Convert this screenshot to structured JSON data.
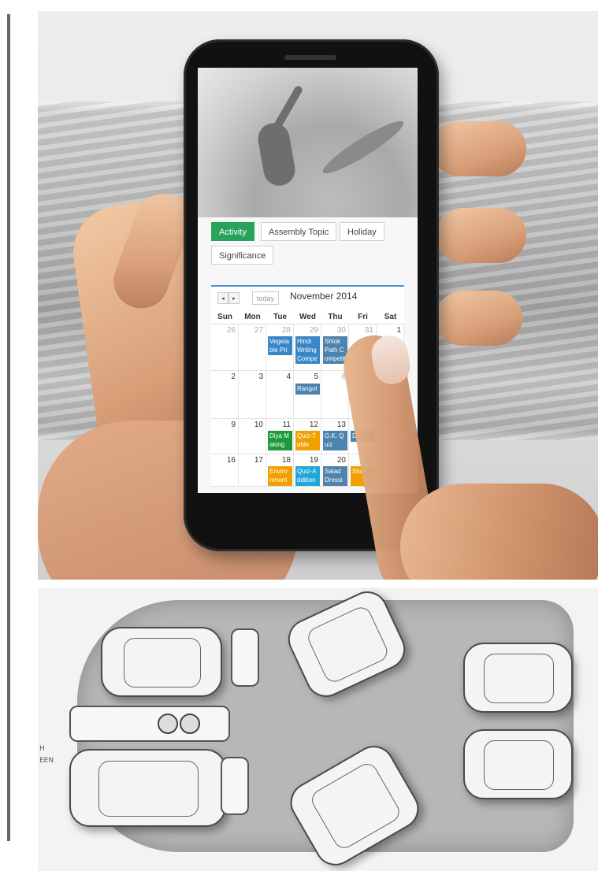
{
  "tabs": [
    "Activity",
    "Assembly Topic",
    "Holiday",
    "Significance"
  ],
  "calendar": {
    "prev_icon": "◂",
    "next_icon": "▸",
    "today_label": "today",
    "title": "November 2014",
    "weekdays": [
      "Sun",
      "Mon",
      "Tue",
      "Wed",
      "Thu",
      "Fri",
      "Sat"
    ],
    "weeks": [
      [
        "26",
        "27",
        "28",
        "29",
        "30",
        "31",
        "1"
      ],
      [
        "2",
        "3",
        "4",
        "5",
        "6",
        "",
        ""
      ],
      [
        "9",
        "10",
        "11",
        "12",
        "13",
        "",
        ""
      ],
      [
        "16",
        "17",
        "18",
        "19",
        "20",
        "21",
        ""
      ]
    ],
    "events": {
      "w0_tue": "Vegetable Printing",
      "w0_wed": "Hindi Writing Competition",
      "w0_thu": "Shlok Path Competition",
      "w1_wed": "Rangoli",
      "w2_tue": "Diya Making",
      "w2_wed": "Quiz-Table",
      "w2_thu": "G.K. Quiz",
      "w2_fri": "Dance",
      "w3_tue": "Environment",
      "w3_wed": "Quiz-Addition",
      "w3_thu": "Salad Dressing",
      "w3_fri": "Story"
    },
    "colors": {
      "accent": "#4a90d9",
      "active_tab": "#27a35b"
    }
  },
  "sketch": {
    "note_lines": [
      "H",
      "EEN"
    ]
  }
}
